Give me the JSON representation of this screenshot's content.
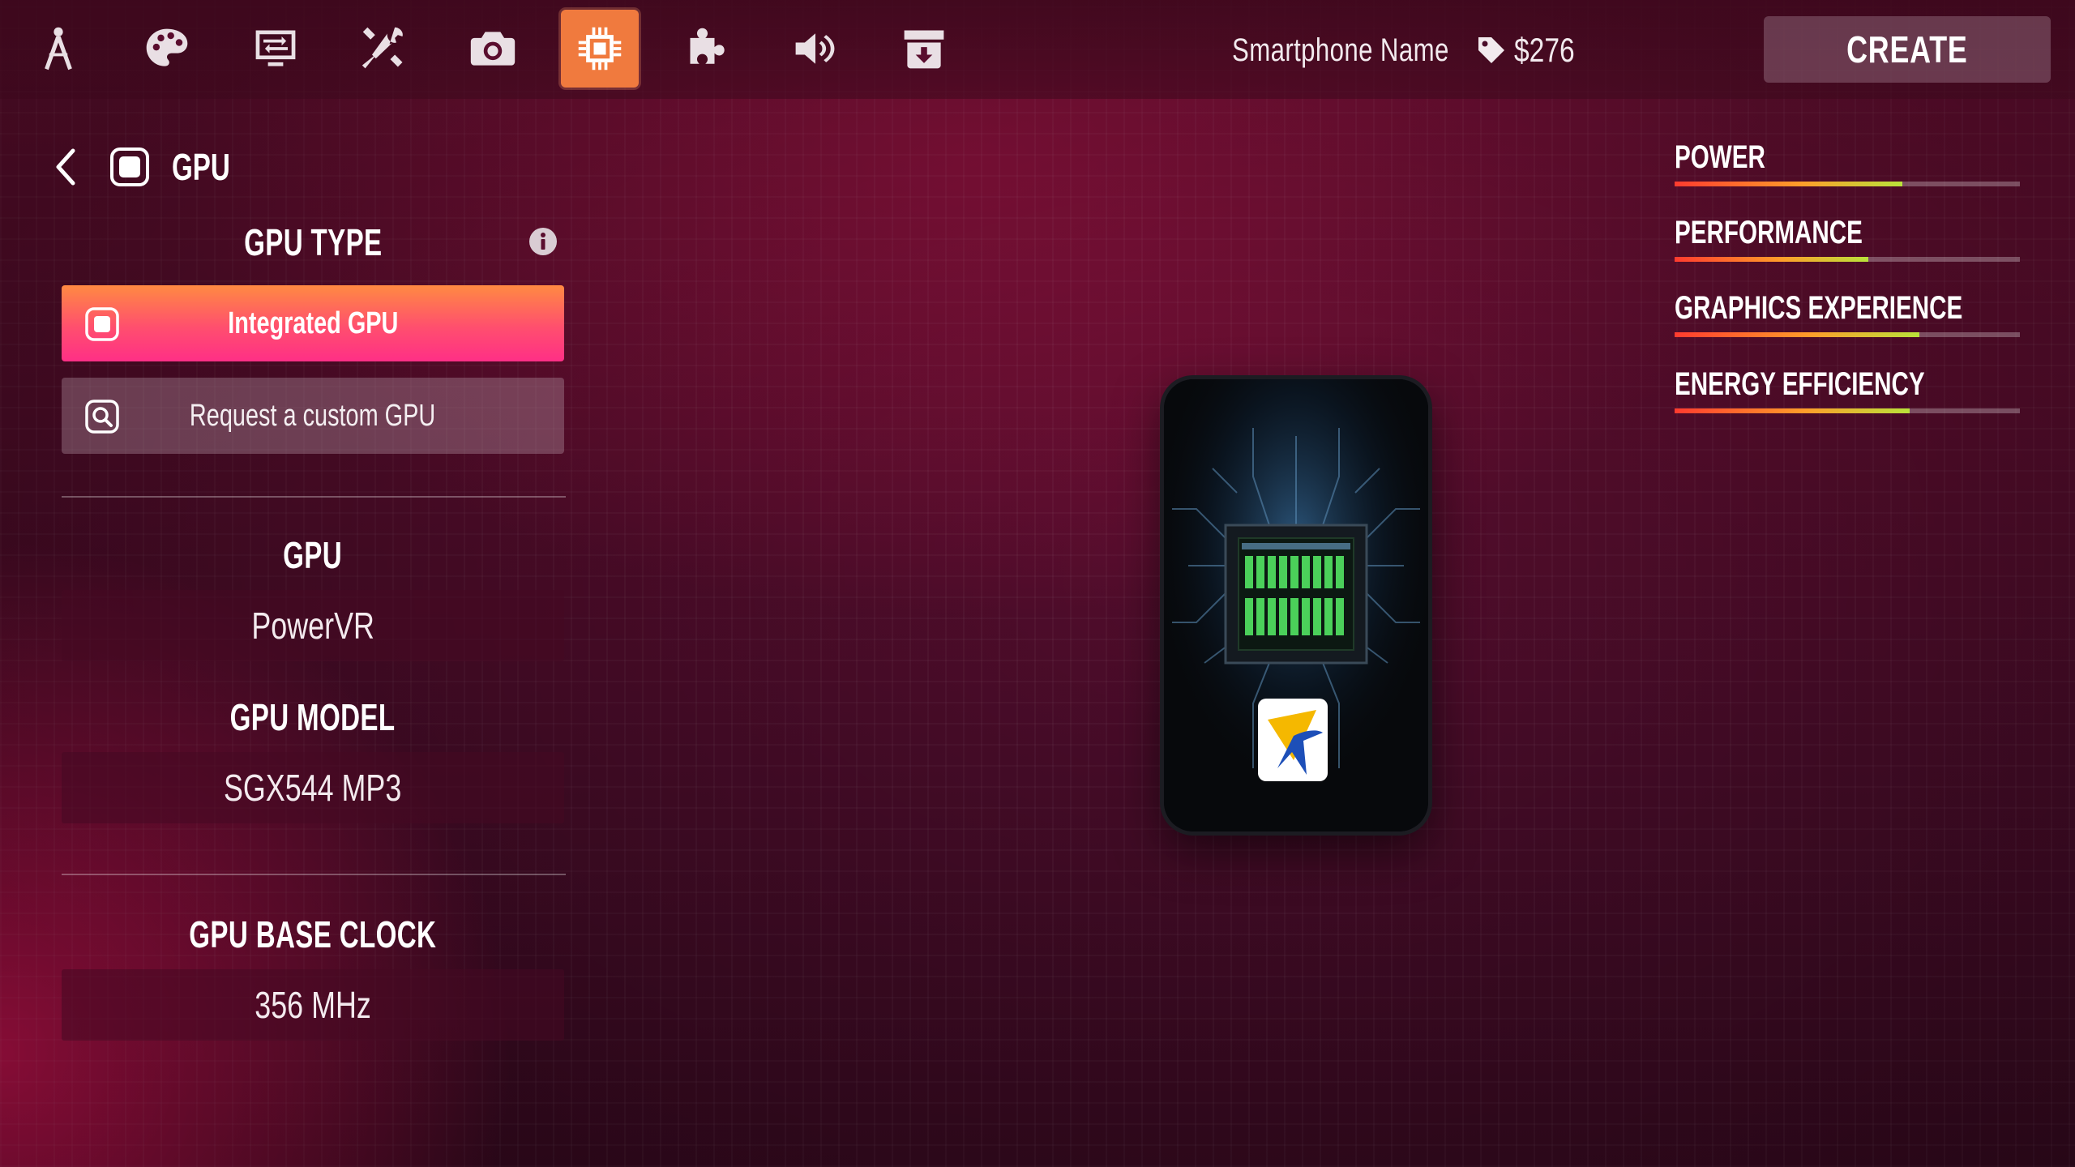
{
  "toolbar": {
    "items": [
      {
        "icon": "design-compass-icon",
        "active": false
      },
      {
        "icon": "palette-icon",
        "active": false
      },
      {
        "icon": "display-settings-icon",
        "active": false
      },
      {
        "icon": "tools-icon",
        "active": false
      },
      {
        "icon": "camera-icon",
        "active": false
      },
      {
        "icon": "chip-icon",
        "active": true
      },
      {
        "icon": "puzzle-icon",
        "active": false
      },
      {
        "icon": "speaker-icon",
        "active": false
      },
      {
        "icon": "package-icon",
        "active": false
      }
    ],
    "active_color": "#f07a3e"
  },
  "header": {
    "phone_name": "Smartphone  Name",
    "price": "$276",
    "create_label": "CREATE"
  },
  "panel": {
    "title": "GPU",
    "gpu_type_heading": "GPU TYPE",
    "options": {
      "integrated": "Integrated GPU",
      "custom": "Request a custom GPU"
    },
    "gpu_heading": "GPU",
    "gpu_value": "PowerVR",
    "model_heading": "GPU MODEL",
    "model_value": "SGX544 MP3",
    "clock_heading": "GPU BASE CLOCK",
    "clock_value": "356 MHz"
  },
  "stats": [
    {
      "label": "POWER",
      "level": 0.66
    },
    {
      "label": "PERFORMANCE",
      "level": 0.56
    },
    {
      "label": "GRAPHICS EXPERIENCE",
      "level": 0.71
    },
    {
      "label": "ENERGY EFFICIENCY",
      "level": 0.68
    }
  ]
}
